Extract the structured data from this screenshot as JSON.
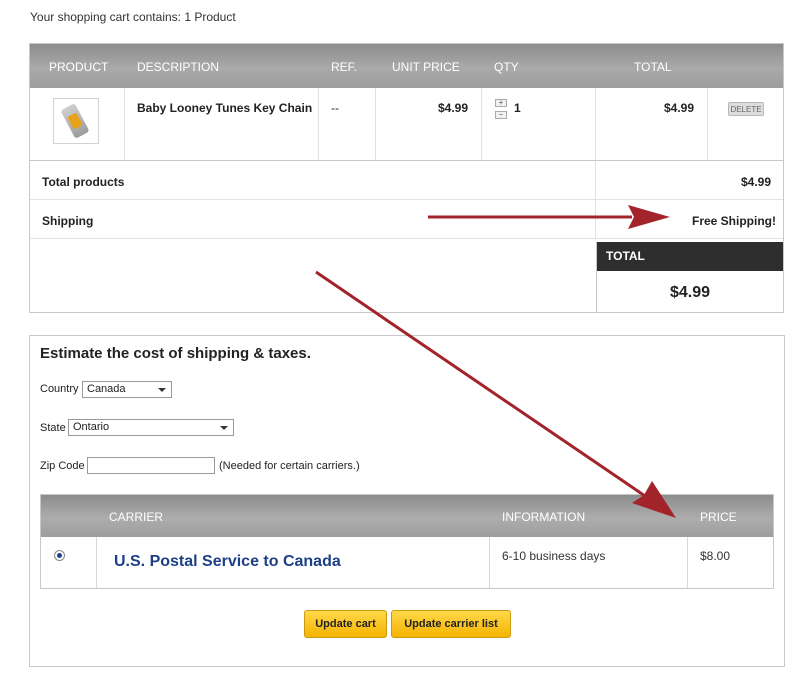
{
  "cart_summary": "Your shopping cart contains: 1 Product",
  "cart": {
    "headers": {
      "product": "PRODUCT",
      "description": "DESCRIPTION",
      "ref": "REF.",
      "unit_price": "UNIT PRICE",
      "qty": "QTY",
      "total": "TOTAL"
    },
    "item": {
      "description": "Baby Looney Tunes Key Chain",
      "ref": "--",
      "unit_price": "$4.99",
      "qty_plus": "+",
      "qty_minus": "−",
      "qty": "1",
      "total": "$4.99",
      "delete_label": "DELETE"
    },
    "total_products_label": "Total products",
    "total_products_value": "$4.99",
    "shipping_label": "Shipping",
    "shipping_value": "Free Shipping!",
    "total_label": "TOTAL",
    "total_value": "$4.99"
  },
  "estimate": {
    "title": "Estimate the cost of shipping & taxes.",
    "country_label": "Country",
    "country_value": "Canada",
    "state_label": "State",
    "state_value": "Ontario",
    "zip_label": "Zip Code",
    "zip_value": "",
    "zip_note": "(Needed for certain carriers.)",
    "carrier_table": {
      "headers": {
        "carrier": "CARRIER",
        "information": "INFORMATION",
        "price": "PRICE"
      },
      "rows": [
        {
          "name": "U.S. Postal Service to Canada",
          "information": "6-10 business days",
          "price": "$8.00",
          "selected": true
        }
      ]
    },
    "buttons": {
      "update_cart": "Update cart",
      "update_carrier_list": "Update carrier list"
    }
  },
  "colors": {
    "header_gray": "#9d9d9d",
    "total_dark": "#2e2e2e",
    "carrier_blue": "#1c3f87",
    "button_yellow": "#f5b400",
    "arrow_red": "#a3232b"
  }
}
